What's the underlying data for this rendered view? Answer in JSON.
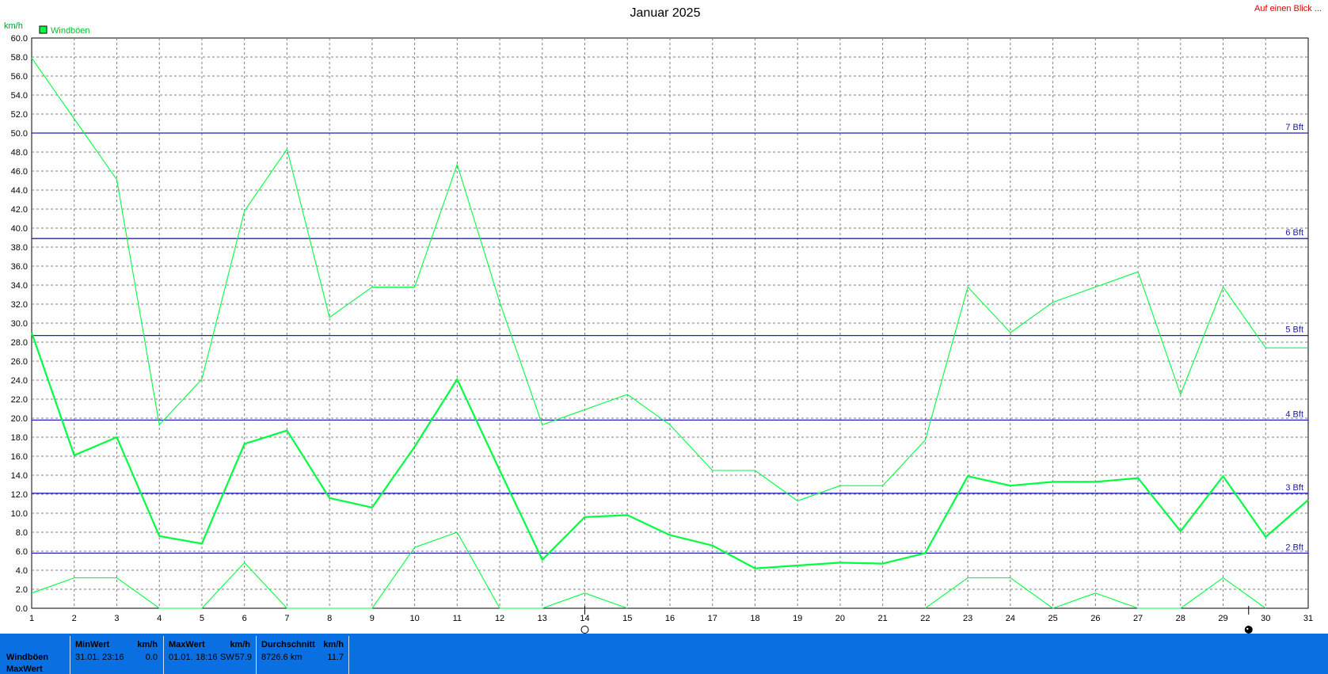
{
  "chart_data": {
    "type": "line",
    "title": "Januar 2025",
    "ylabel": "km/h",
    "xlabel": "",
    "ylim": [
      0,
      60
    ],
    "y_tick_step": 2,
    "x": [
      1,
      2,
      3,
      4,
      5,
      6,
      7,
      8,
      9,
      10,
      11,
      12,
      13,
      14,
      15,
      16,
      17,
      18,
      19,
      20,
      21,
      22,
      23,
      24,
      25,
      26,
      27,
      28,
      29,
      30,
      31
    ],
    "legend": {
      "label": "Windböen",
      "color": "#00ff40",
      "position": "top-left"
    },
    "grid": true,
    "series": [
      {
        "name": "Windböen",
        "role": "max",
        "color": "#00ff40",
        "values": [
          57.9,
          51.5,
          45.1,
          19.3,
          24.1,
          41.8,
          48.3,
          30.6,
          33.8,
          33.8,
          46.7,
          32.2,
          19.3,
          20.9,
          22.5,
          19.3,
          14.5,
          14.5,
          11.3,
          12.9,
          12.9,
          17.7,
          33.8,
          29.0,
          32.2,
          33.8,
          35.4,
          22.5,
          33.8,
          27.4,
          27.4
        ]
      },
      {
        "role": "mean",
        "color": "#00ff40",
        "values": [
          29.0,
          16.1,
          18.0,
          7.6,
          6.8,
          17.3,
          18.7,
          11.6,
          10.6,
          17.0,
          24.1,
          14.5,
          5.1,
          9.6,
          9.8,
          7.7,
          6.6,
          4.2,
          4.5,
          4.8,
          4.7,
          5.8,
          13.9,
          12.9,
          13.3,
          13.3,
          13.7,
          8.1,
          13.9,
          7.5,
          11.4
        ]
      },
      {
        "role": "min",
        "color": "#00ff40",
        "values": [
          1.6,
          3.2,
          3.2,
          0.0,
          0.0,
          4.8,
          0.0,
          0.0,
          0.0,
          6.4,
          8.0,
          0.0,
          0.0,
          1.6,
          0.0,
          null,
          null,
          null,
          null,
          null,
          null,
          0.0,
          3.2,
          3.2,
          0.0,
          1.6,
          0.0,
          0.0,
          3.2,
          0.0,
          null
        ]
      }
    ],
    "beaufort_lines": [
      {
        "label": "2 Bft",
        "value": 5.8
      },
      {
        "label": "3 Bft",
        "value": 12.1
      },
      {
        "label": "4 Bft",
        "value": 19.8
      },
      {
        "label": "5 Bft",
        "value": 28.7
      },
      {
        "label": "6 Bft",
        "value": 38.9
      },
      {
        "label": "7 Bft",
        "value": 50.0
      }
    ],
    "moon_phases": [
      {
        "day": 14,
        "phase": "full-moon"
      },
      {
        "day": 29.6,
        "phase": "new-moon"
      }
    ]
  },
  "header": {
    "glance_link": "Auf einen Blick ..."
  },
  "footer": {
    "row_labels": [
      "Windböen",
      "MaxWert"
    ],
    "min": {
      "head": "MinWert",
      "unit": "km/h",
      "date": "31.01.",
      "time": "23:16",
      "value": "0.0"
    },
    "max": {
      "head": "MaxWert",
      "unit": "km/h",
      "date": "01.01.",
      "time": "18:16",
      "dir": "SW",
      "value": "57.9"
    },
    "avg": {
      "head": "Durchschnitt",
      "unit": "km/h",
      "distance": "8726.6 km",
      "value": "11.7"
    }
  },
  "colors": {
    "grid": "#808080",
    "beaufort": "#2020c0",
    "footer": "#0a6fe0",
    "line": "#00ff40"
  }
}
